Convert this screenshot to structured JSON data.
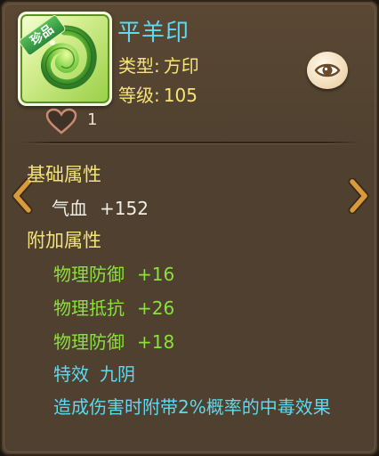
{
  "item": {
    "name": "平羊印",
    "rarity_tag": "珍品",
    "type_label": "类型:",
    "type_value": "方印",
    "level_label": "等级:",
    "level_value": "105",
    "icon": "green-jade-spiral-seal-icon"
  },
  "likes": {
    "count": "1",
    "icon": "heart-outline-icon"
  },
  "view_button": {
    "icon": "eye-icon"
  },
  "nav": {
    "prev_icon": "chevron-left-icon",
    "next_icon": "chevron-right-icon"
  },
  "base_attributes": {
    "title": "基础属性",
    "stats": [
      {
        "name": "气血",
        "value": "+152"
      }
    ]
  },
  "extra_attributes": {
    "title": "附加属性",
    "stats": [
      {
        "name": "物理防御",
        "value": "+16"
      },
      {
        "name": "物理抵抗",
        "value": "+26"
      },
      {
        "name": "物理防御",
        "value": "+18"
      }
    ]
  },
  "special_effect": {
    "label": "特效",
    "name": "九阴",
    "description": "造成伤害时附带2%概率的中毒效果"
  },
  "colors": {
    "panel_bg": "#4f402f",
    "name_cyan": "#5ed9ee",
    "label_yellow": "#f5e37a",
    "stat_green": "#8ce03c",
    "arrow_orange": "#d99a3c"
  }
}
